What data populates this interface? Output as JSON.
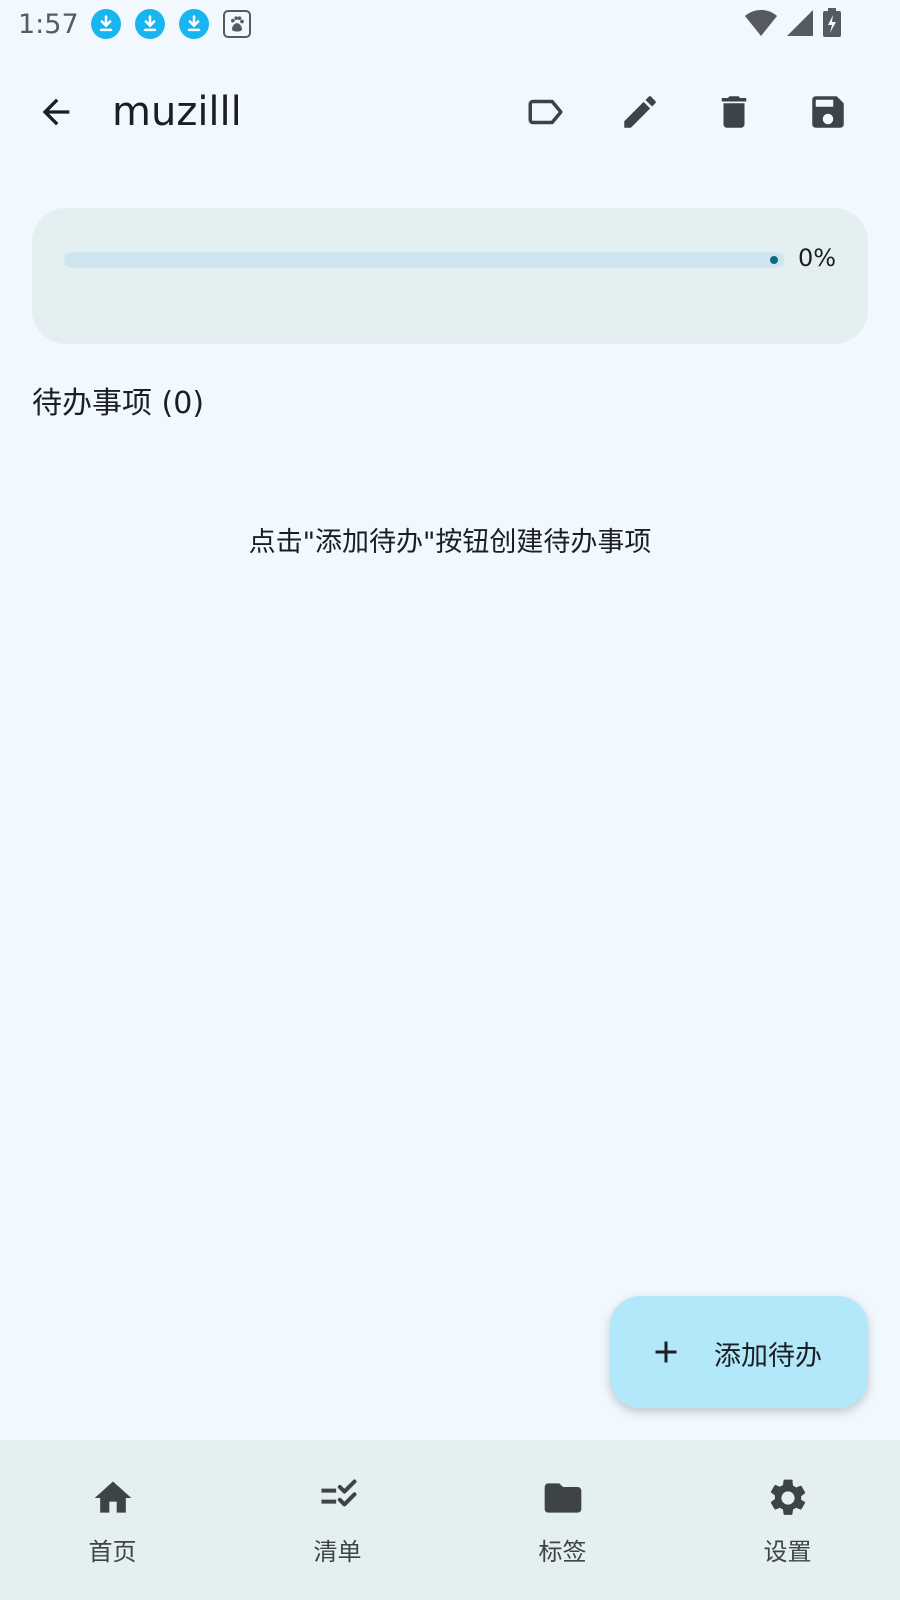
{
  "status_bar": {
    "time": "1:57",
    "icons": [
      "download-icon",
      "download-icon",
      "download-icon",
      "baidu-paw-icon",
      "wifi-icon",
      "signal-icon",
      "battery-charging-icon"
    ]
  },
  "app_bar": {
    "title": "muzilll",
    "actions": [
      "label-icon",
      "edit-icon",
      "delete-icon",
      "save-icon"
    ]
  },
  "progress": {
    "value": 0,
    "label": "0%"
  },
  "todos": {
    "section_title": "待办事项 (0)",
    "empty_hint": "点击\"添加待办\"按钮创建待办事项"
  },
  "fab": {
    "label": "添加待办"
  },
  "bottom_nav": {
    "items": [
      {
        "label": "首页",
        "icon": "home-icon"
      },
      {
        "label": "清单",
        "icon": "checklist-icon"
      },
      {
        "label": "标签",
        "icon": "folder-icon"
      },
      {
        "label": "设置",
        "icon": "settings-icon"
      }
    ]
  },
  "colors": {
    "background": "#f1f8fe",
    "card": "#e4eff2",
    "accent": "#b3e8fb",
    "download_badge": "#18b5f0"
  }
}
